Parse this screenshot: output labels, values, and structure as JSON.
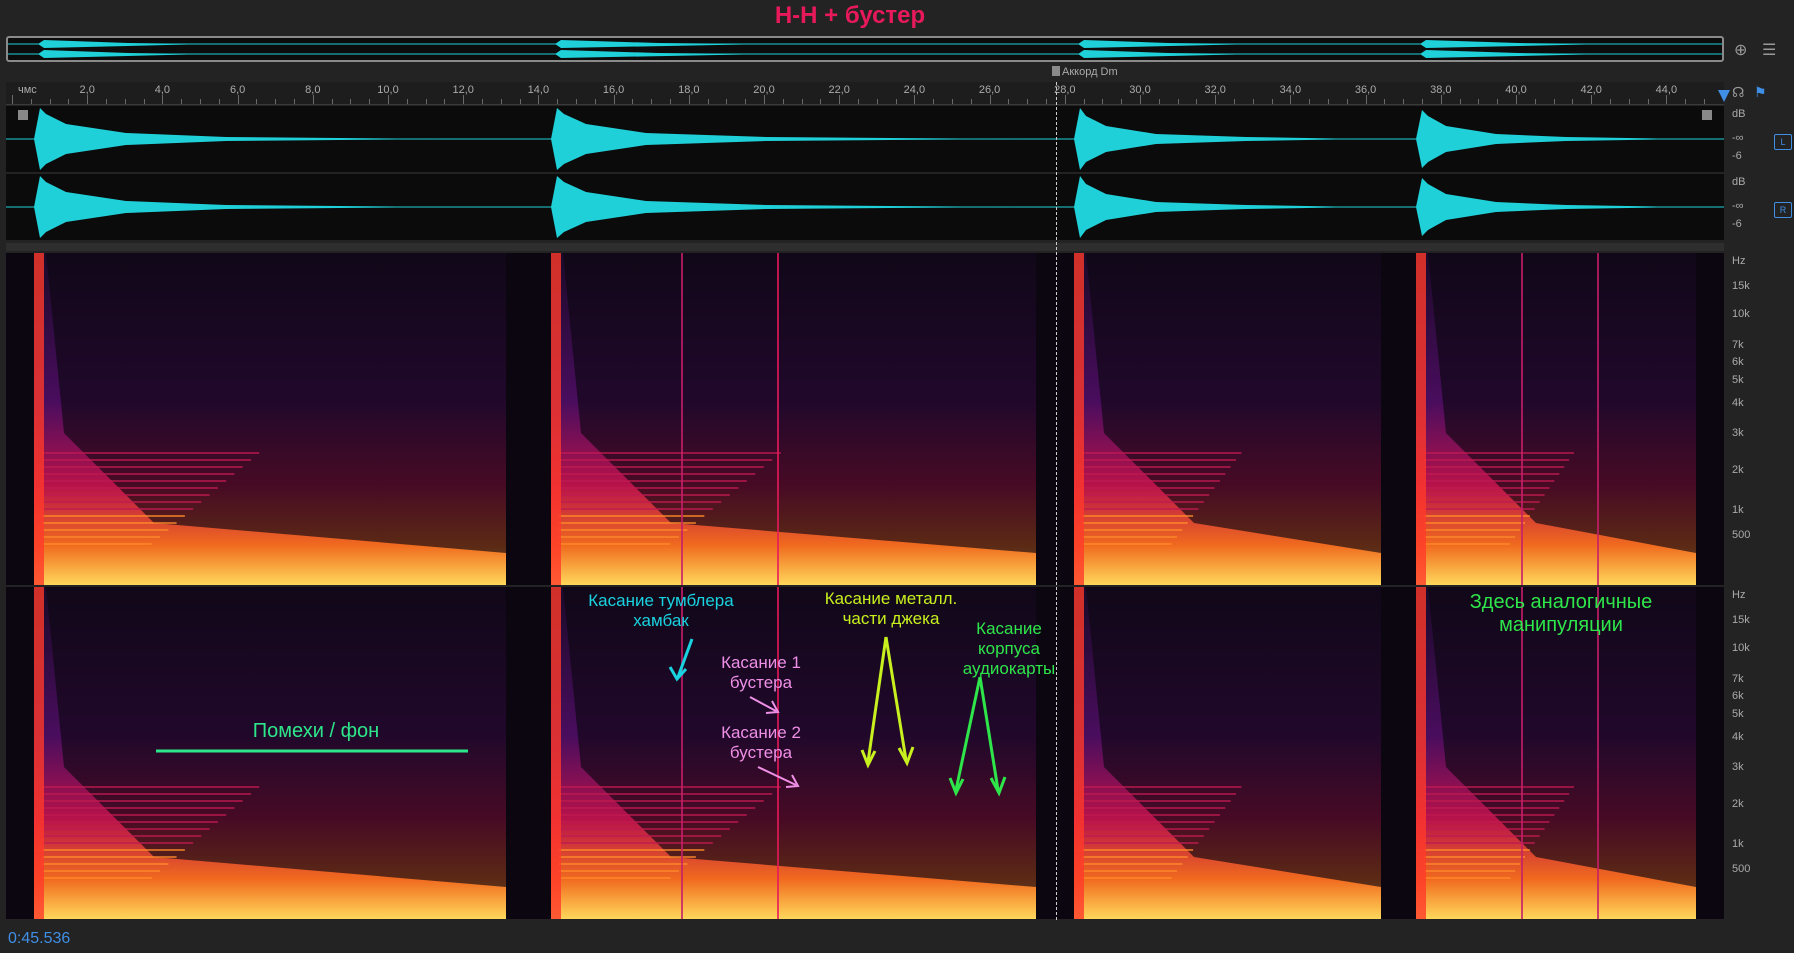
{
  "title": "H-H + бустер",
  "ruler": {
    "unit_label": "чмс",
    "ticks": [
      "2,0",
      "4,0",
      "6,0",
      "8,0",
      "10,0",
      "12,0",
      "14,0",
      "16,0",
      "18,0",
      "20,0",
      "22,0",
      "24,0",
      "26,0",
      "28,0",
      "30,0",
      "32,0",
      "34,0",
      "36,0",
      "38,0",
      "40,0",
      "42,0",
      "44,0"
    ]
  },
  "marker": {
    "label": "Аккорд Dm"
  },
  "amplitude_scale": {
    "unit": "dB",
    "values": [
      "-∞",
      "-6"
    ]
  },
  "channel_buttons": {
    "left": "L",
    "right": "R"
  },
  "frequency_scale": {
    "unit": "Hz",
    "labels": [
      "15k",
      "10k",
      "7k",
      "6k",
      "5k",
      "4k",
      "3k",
      "2k",
      "1k",
      "500"
    ]
  },
  "annotations": [
    {
      "text": "Касание тумблера хамбак",
      "color": "#19d3e0"
    },
    {
      "text": "Касание 1 бустера",
      "color": "#ef8fe6"
    },
    {
      "text": "Касание 2 бустера",
      "color": "#ef8fe6"
    },
    {
      "text": "Касание металл. части джека",
      "color": "#c8f01e"
    },
    {
      "text": "Касание корпуса аудиокарты",
      "color": "#2ee64a"
    },
    {
      "text": "Помехи / фон",
      "color": "#2ee68a"
    },
    {
      "text": "Здесь аналогичные манипуляции",
      "color": "#2ee64a"
    }
  ],
  "timecode": "0:45.536",
  "colors": {
    "accent": "#3f8fe6",
    "title": "#e8195b",
    "waveform": "#1fd0d8"
  }
}
